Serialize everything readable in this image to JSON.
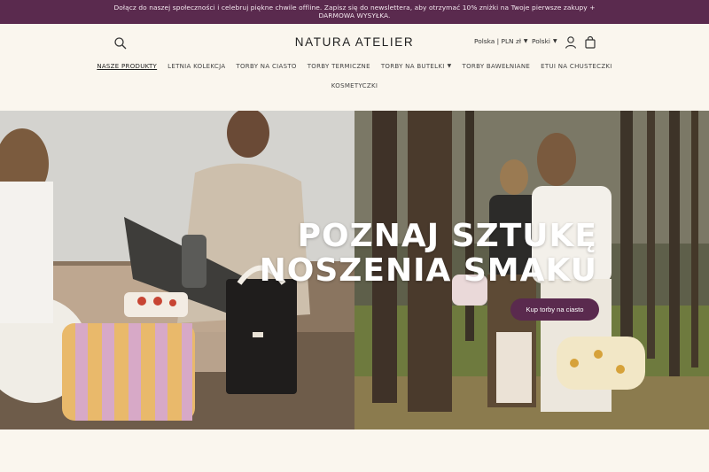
{
  "announcement": {
    "line1": "Dołącz do naszej społeczności i celebruj piękne chwile offline. Zapisz się do newslettera, aby otrzymać 10% zniżki na Twoje pierwsze zakupy +",
    "line2": "DARMOWA WYSYŁKA."
  },
  "header": {
    "logo": "NATURA ATELIER",
    "country": "Polska | PLN zł",
    "language": "Polski",
    "icons": [
      "search-icon",
      "chevron-down-icon",
      "user-icon",
      "cart-icon"
    ]
  },
  "nav": {
    "items": [
      {
        "label": "NASZE PRODUKTY"
      },
      {
        "label": "LETNIA KOLEKCJA"
      },
      {
        "label": "TORBY NA CIASTO"
      },
      {
        "label": "TORBY TERMICZNE"
      },
      {
        "label": "TORBY NA BUTELKI"
      },
      {
        "label": "TORBY BAWEŁNIANE"
      },
      {
        "label": "ETUI NA CHUSTECZKI"
      },
      {
        "label": "KOSMETYCZKI"
      }
    ]
  },
  "hero": {
    "title_line1": "POZNAJ SZTUKĘ",
    "title_line2": "NOSZENIA SMAKU",
    "cta": "Kup torby na ciasto"
  },
  "colors": {
    "brand": "#5a2a4e",
    "background": "#faf6ee"
  }
}
